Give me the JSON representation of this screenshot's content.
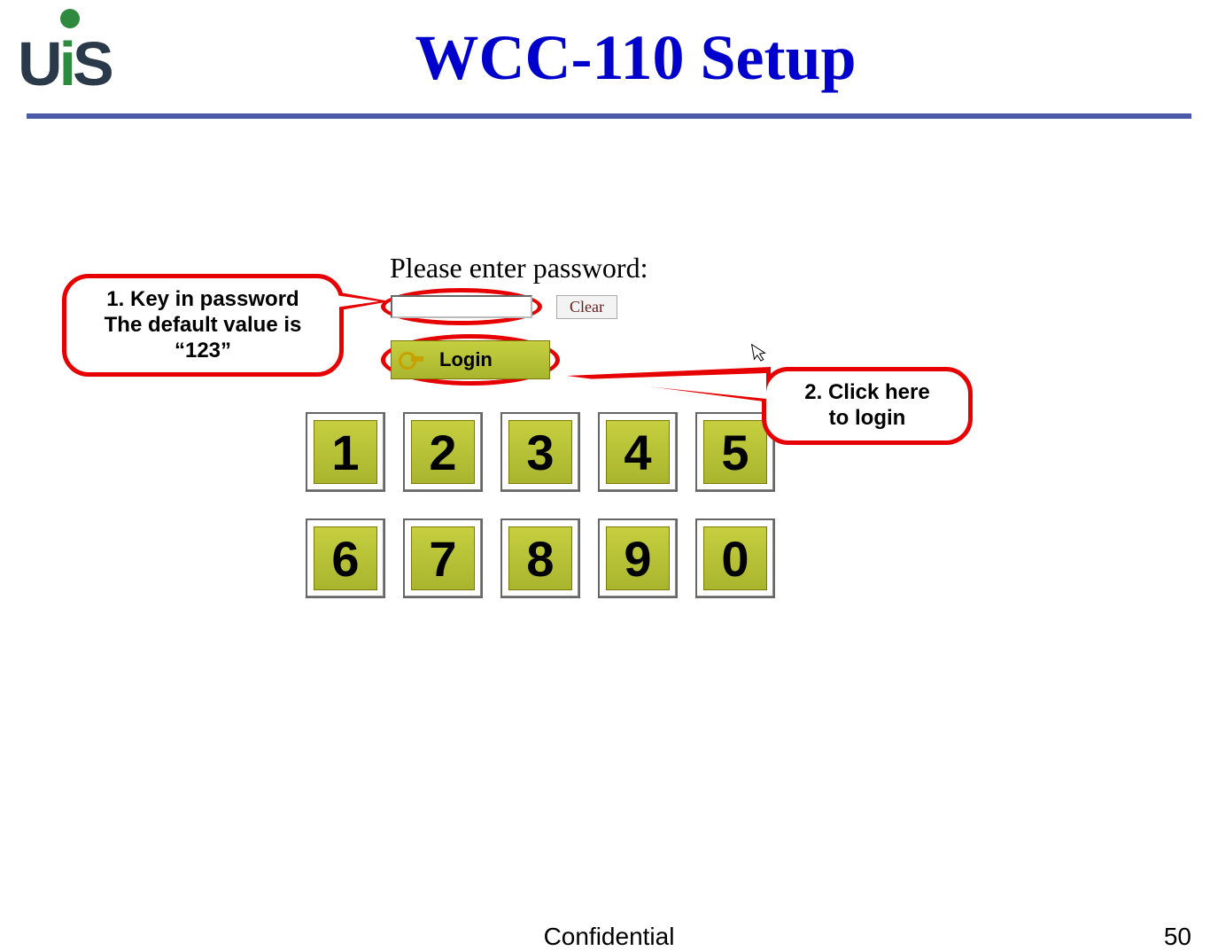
{
  "header": {
    "logo_text_u": "U",
    "logo_text_i": "i",
    "logo_text_s": "S",
    "title": "WCC-110 Setup"
  },
  "login": {
    "prompt": "Please enter password:",
    "clear_label": "Clear",
    "login_label": "Login"
  },
  "keypad": {
    "row1": [
      "1",
      "2",
      "3",
      "4",
      "5"
    ],
    "row2": [
      "6",
      "7",
      "8",
      "9",
      "0"
    ]
  },
  "callouts": {
    "c1_line1": "1. Key in password",
    "c1_line2": "The default value is",
    "c1_line3": "“123”",
    "c2_line1": "2. Click here",
    "c2_line2": "to login"
  },
  "footer": {
    "center": "Confidential",
    "page": "50"
  }
}
